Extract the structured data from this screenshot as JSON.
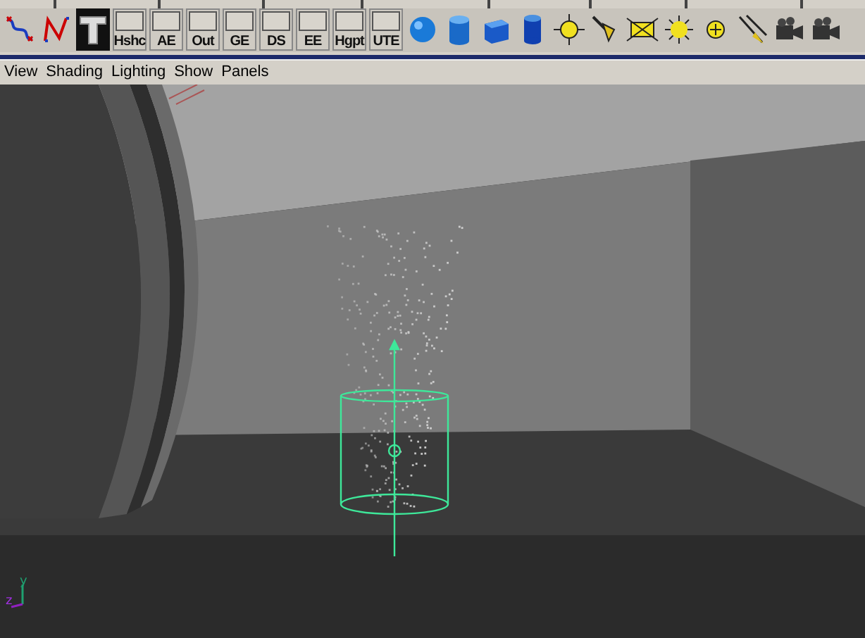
{
  "shelf": {
    "buttons": [
      "Hshc",
      "AE",
      "Out",
      "GE",
      "DS",
      "EE",
      "Hgpt",
      "UTE"
    ]
  },
  "panel_menu": [
    "View",
    "Shading",
    "Lighting",
    "Show",
    "Panels"
  ],
  "axis": {
    "y": "y",
    "z": "z"
  }
}
